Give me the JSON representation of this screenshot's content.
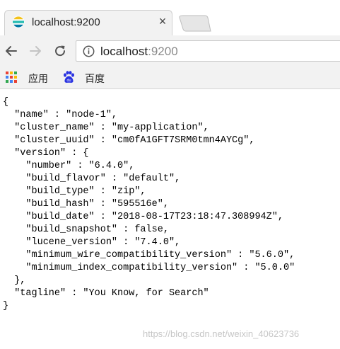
{
  "tab": {
    "title": "localhost:9200",
    "close_glyph": "×",
    "favicon": "elastic-logo-icon"
  },
  "toolbar": {
    "url_host": "localhost",
    "url_port": ":9200",
    "icons": [
      "back-icon",
      "forward-icon",
      "reload-icon",
      "info-icon"
    ]
  },
  "bookmarks": {
    "items": [
      {
        "label": "应用",
        "icon": "apps-grid-icon"
      },
      {
        "label": "百度",
        "icon": "baidu-paw-icon"
      }
    ]
  },
  "json_lines": [
    "{",
    "  \"name\" : \"node-1\",",
    "  \"cluster_name\" : \"my-application\",",
    "  \"cluster_uuid\" : \"cm0fA1GFT7SRM0tmn4AYCg\",",
    "  \"version\" : {",
    "    \"number\" : \"6.4.0\",",
    "    \"build_flavor\" : \"default\",",
    "    \"build_type\" : \"zip\",",
    "    \"build_hash\" : \"595516e\",",
    "    \"build_date\" : \"2018-08-17T23:18:47.308994Z\",",
    "    \"build_snapshot\" : false,",
    "    \"lucene_version\" : \"7.4.0\",",
    "    \"minimum_wire_compatibility_version\" : \"5.6.0\",",
    "    \"minimum_index_compatibility_version\" : \"5.0.0\"",
    "  },",
    "  \"tagline\" : \"You Know, for Search\"",
    "}"
  ],
  "watermark": "https://blog.csdn.net/weixin_40623736",
  "colors": {
    "chrome_bg": "#f2f2f2",
    "elastic_yellow": "#f3c21b",
    "elastic_teal": "#24bbb1",
    "elastic_blue": "#0079a5",
    "baidu_blue": "#2932e1"
  }
}
